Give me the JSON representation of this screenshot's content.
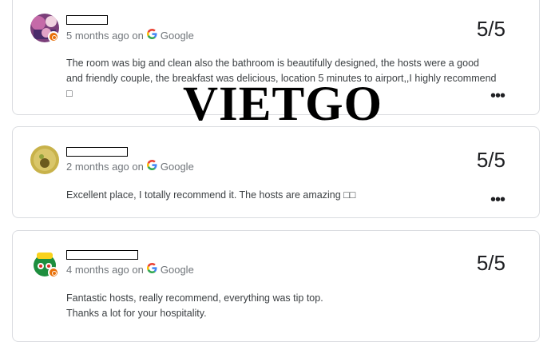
{
  "reviews": [
    {
      "time": "5 months ago",
      "on": "on",
      "source": "Google",
      "score": "5/5",
      "text": "The room was big and clean also the bathroom is beautifully designed, the hosts were a good and friendly couple, the breakfast was delicious, location 5 minutes to airport,,I highly recommend □",
      "local_guide": true
    },
    {
      "time": "2 months ago",
      "on": "on",
      "source": "Google",
      "score": "5/5",
      "text": "Excellent place, I totally recommend it. The hosts are amazing □□",
      "local_guide": false
    },
    {
      "time": "4 months ago",
      "on": "on",
      "source": "Google",
      "score": "5/5",
      "text_line1": "Fantastic hosts, really recommend, everything was tip top.",
      "text_line2": "Thanks a lot for your hospitality.",
      "local_guide": true
    }
  ],
  "more_menu": "•••",
  "watermark": "VIETGO",
  "colors": {
    "accent": "#1a73e8",
    "badge": "#e8710a",
    "border": "#dadce0"
  }
}
